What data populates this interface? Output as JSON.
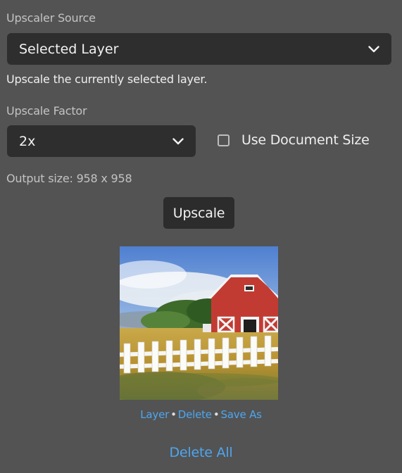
{
  "source": {
    "label": "Upscaler Source",
    "selected": "Selected Layer",
    "description": "Upscale the currently selected layer."
  },
  "factor": {
    "label": "Upscale Factor",
    "selected": "2x",
    "use_doc_size_label": "Use Document Size",
    "use_doc_size_checked": false
  },
  "output_size": "Output size: 958 x 958",
  "upscale_button": "Upscale",
  "result": {
    "thumbnail_icon": "barn-landscape-image",
    "actions": {
      "layer": "Layer",
      "delete": "Delete",
      "save_as": "Save As",
      "separator": "•"
    }
  },
  "delete_all": "Delete All",
  "colors": {
    "panel_bg": "#535353",
    "control_bg": "#2e2e2e",
    "link": "#4ea6f0"
  }
}
